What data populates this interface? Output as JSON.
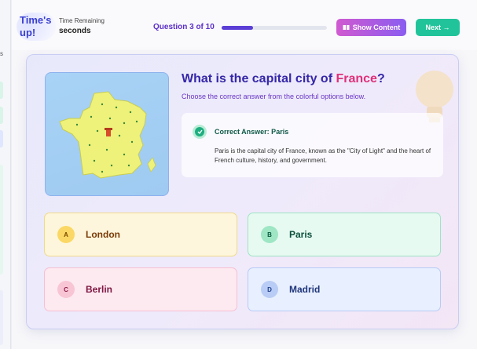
{
  "header": {
    "times_up_label": "Time's up!",
    "time_remaining_label": "Time Remaining",
    "time_remaining_value": "seconds",
    "question_counter": "Question 3 of 10",
    "progress": 0.3,
    "show_content_label": "Show Content",
    "next_label": "Next →"
  },
  "question": {
    "title_prefix": "What is the capital city of ",
    "title_highlight": "France",
    "title_suffix": "?",
    "subtitle": "Choose the correct answer from the colorful options below.",
    "map_icon": "france-map-icon",
    "decoration_icon": "lightbulb-icon"
  },
  "answer": {
    "heading": "Correct Answer: Paris",
    "description": "Paris is the capital city of France, known as the \"City of Light\" and the heart of French culture, history, and government.",
    "icon": "check-icon"
  },
  "options": [
    {
      "letter": "A",
      "text": "London"
    },
    {
      "letter": "B",
      "text": "Paris"
    },
    {
      "letter": "C",
      "text": "Berlin"
    },
    {
      "letter": "D",
      "text": "Madrid"
    }
  ],
  "colors": {
    "accent": "#5b2fc9",
    "highlight": "#e0307a",
    "next_button": "#21c49a",
    "correct": "#1fae80"
  }
}
